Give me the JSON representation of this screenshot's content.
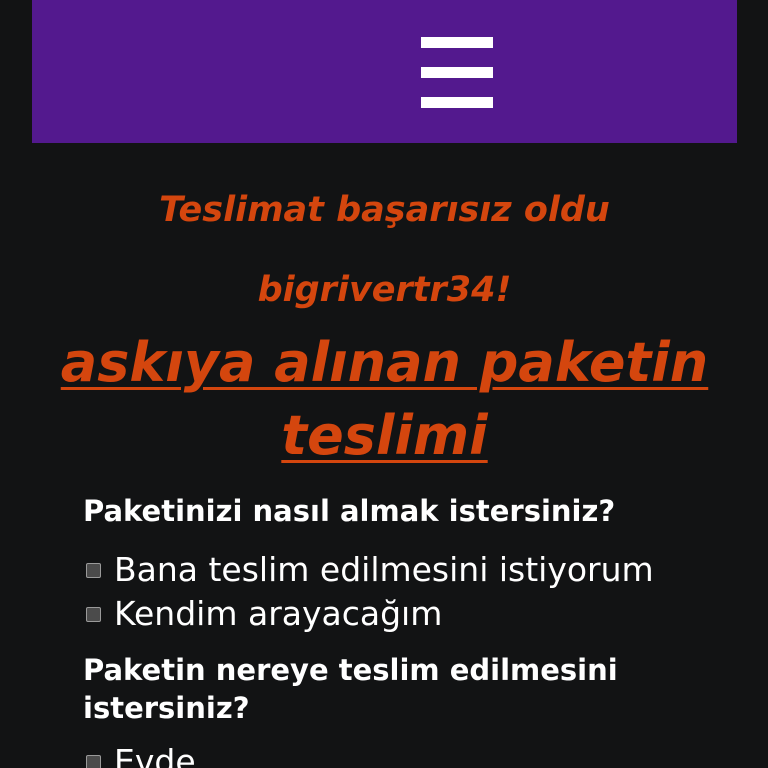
{
  "header": {
    "background_color": "#53198e",
    "menu_icon": "hamburger-menu-icon"
  },
  "status": {
    "line1": "Teslimat başarısız oldu",
    "line2": "bigrivertr34!",
    "color": "#d4460e"
  },
  "suspended": {
    "title": "askıya alınan paketin teslimi"
  },
  "question1": {
    "text": "Paketinizi nasıl almak istersiniz?",
    "options": [
      {
        "label": "Bana teslim edilmesini istiyorum",
        "checked": false
      },
      {
        "label": "Kendim arayacağım",
        "checked": false
      }
    ]
  },
  "question2": {
    "text": "Paketin nereye teslim edilmesini istersiniz?",
    "options": [
      {
        "label": "Evde",
        "checked": false
      }
    ]
  }
}
